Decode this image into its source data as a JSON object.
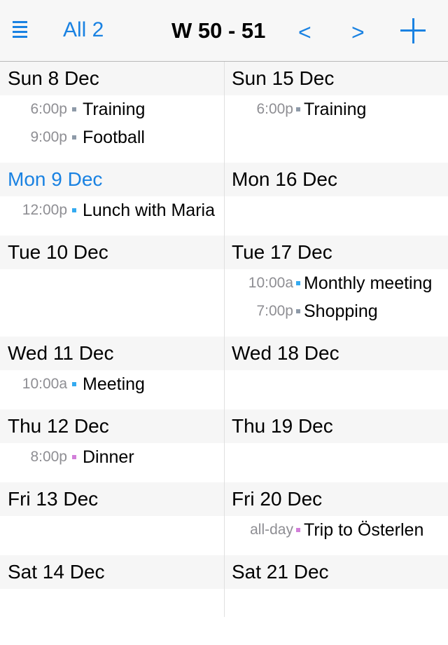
{
  "header": {
    "menu_icon": "list-icon",
    "filter_label": "All 2",
    "title": "W 50 - 51",
    "prev_label": "<",
    "next_label": ">",
    "add_icon": "plus-icon"
  },
  "colors": {
    "accent": "#1a82e2",
    "gray_calendar": "#8e9aa8",
    "blue_calendar": "#34aaf0",
    "purple_calendar": "#d27fd9"
  },
  "weeks": [
    {
      "days": [
        {
          "label": "Sun 8 Dec",
          "today": false,
          "events": [
            {
              "time": "6:00p",
              "title": "Training",
              "color": "#8e9aa8"
            },
            {
              "time": "9:00p",
              "title": "Football",
              "color": "#8e9aa8"
            }
          ]
        },
        {
          "label": "Mon 9 Dec",
          "today": true,
          "events": [
            {
              "time": "12:00p",
              "title": "Lunch with Maria",
              "color": "#34aaf0"
            }
          ]
        },
        {
          "label": "Tue 10 Dec",
          "today": false,
          "events": []
        },
        {
          "label": "Wed 11 Dec",
          "today": false,
          "events": [
            {
              "time": "10:00a",
              "title": "Meeting",
              "color": "#34aaf0"
            }
          ]
        },
        {
          "label": "Thu 12 Dec",
          "today": false,
          "events": [
            {
              "time": "8:00p",
              "title": "Dinner",
              "color": "#d27fd9"
            }
          ]
        },
        {
          "label": "Fri 13 Dec",
          "today": false,
          "events": []
        },
        {
          "label": "Sat 14 Dec",
          "today": false,
          "events": []
        }
      ]
    },
    {
      "days": [
        {
          "label": "Sun 15 Dec",
          "today": false,
          "events": [
            {
              "time": "6:00p",
              "title": "Training",
              "color": "#8e9aa8"
            }
          ]
        },
        {
          "label": "Mon 16 Dec",
          "today": false,
          "events": []
        },
        {
          "label": "Tue 17 Dec",
          "today": false,
          "events": [
            {
              "time": "10:00a",
              "title": "Monthly meeting",
              "color": "#34aaf0"
            },
            {
              "time": "7:00p",
              "title": "Shopping",
              "color": "#8e9aa8"
            }
          ]
        },
        {
          "label": "Wed 18 Dec",
          "today": false,
          "events": []
        },
        {
          "label": "Thu 19 Dec",
          "today": false,
          "events": []
        },
        {
          "label": "Fri 20 Dec",
          "today": false,
          "events": [
            {
              "time": "all-day",
              "title": "Trip to Österlen",
              "color": "#d27fd9"
            }
          ]
        },
        {
          "label": "Sat 21 Dec",
          "today": false,
          "events": []
        }
      ]
    }
  ]
}
